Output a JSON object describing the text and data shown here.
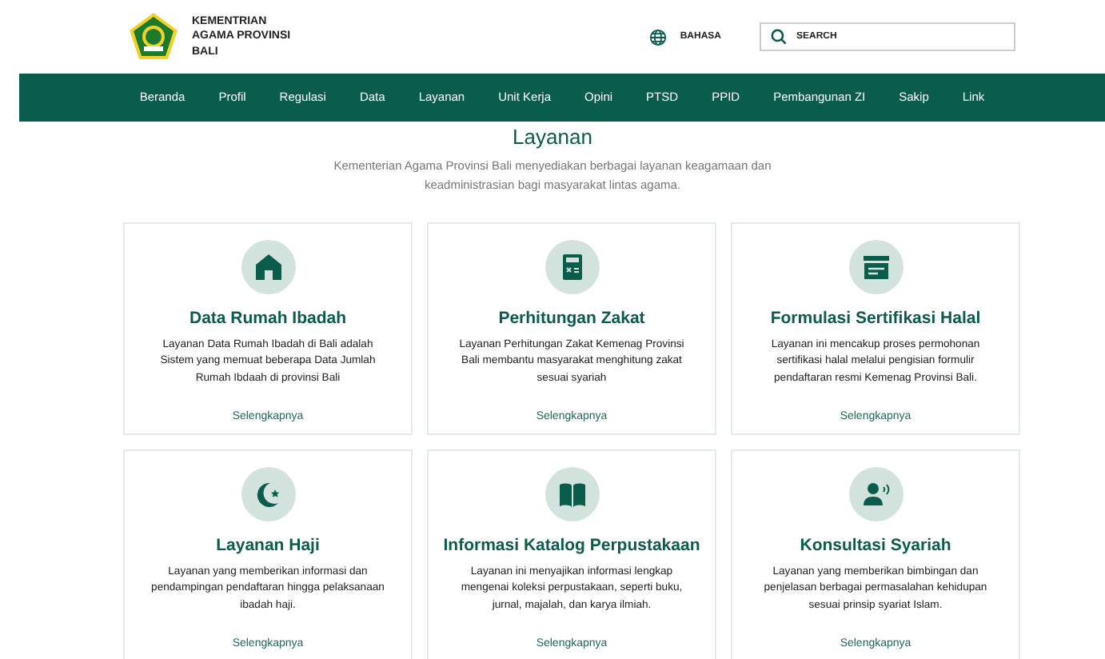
{
  "header": {
    "org_name": "KEMENTRIAN AGAMA PROVINSI BALI",
    "language_label": "BAHASA",
    "search": {
      "placeholder": "SEARCH"
    }
  },
  "nav": [
    {
      "label": "Beranda"
    },
    {
      "label": "Profil"
    },
    {
      "label": "Regulasi"
    },
    {
      "label": "Data"
    },
    {
      "label": "Layanan"
    },
    {
      "label": "Unit Kerja"
    },
    {
      "label": "Opini"
    },
    {
      "label": "PTSD"
    },
    {
      "label": "PPID"
    },
    {
      "label": "Pembangunan ZI"
    },
    {
      "label": "Sakip"
    },
    {
      "label": "Link"
    }
  ],
  "section": {
    "title": "Layanan",
    "subtitle": "Kementerian Agama Provinsi Bali menyediakan berbagai layanan keagamaan dan keadministrasian bagi masyarakat lintas agama."
  },
  "services": [
    {
      "title": "Data Rumah Ibadah",
      "description": "Layanan Data Rumah Ibadah di Bali adalah Sistem yang memuat beberapa Data Jumlah Rumah Ibdaah di provinsi Bali",
      "link": "Selengkapnya"
    },
    {
      "title": "Perhitungan Zakat",
      "description": "Layanan Perhitungan Zakat Kemenag Provinsi Bali membantu masyarakat menghitung zakat sesuai syariah",
      "link": "Selengkapnya"
    },
    {
      "title": "Formulasi Sertifikasi Halal",
      "description": "Layanan ini mencakup proses permohonan sertifikasi halal melalui pengisian formulir pendaftaran resmi Kemenag Provinsi Bali.",
      "link": "Selengkapnya"
    },
    {
      "title": "Layanan Haji",
      "description": "Layanan yang memberikan informasi dan pendampingan pendaftaran hingga pelaksanaan ibadah haji.",
      "link": "Selengkapnya"
    },
    {
      "title": "Informasi Katalog Perpustakaan",
      "description": "Layanan ini menyajikan informasi lengkap mengenai koleksi perpustakaan, seperti buku, jurnal, majalah, dan karya ilmiah.",
      "link": "Selengkapnya"
    },
    {
      "title": "Konsultasi Syariah",
      "description": "Layanan yang memberikan bimbingan dan penjelasan berbagai permasalahan kehidupan sesuai prinsip syariat Islam.",
      "link": "Selengkapnya"
    }
  ]
}
